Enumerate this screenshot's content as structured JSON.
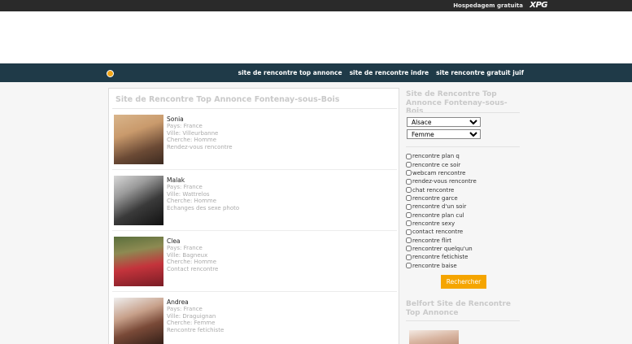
{
  "topbar": {
    "hosting_label": "Hospedagem gratuita",
    "logo_text": "XPG"
  },
  "nav": {
    "home_icon": "home-star-icon",
    "links": [
      "site de rencontre top annonce",
      "site de rencontre indre",
      "site rencontre gratuit juif"
    ]
  },
  "main": {
    "title": "Site de Rencontre Top Annonce Fontenay-sous-Bois",
    "profiles": [
      {
        "name": "Sonia",
        "pays": "Pays: France",
        "ville": "Ville: Villeurbanne",
        "cherche": "Cherche: Homme",
        "tag": "Rendez-vous rencontre"
      },
      {
        "name": "Malak",
        "pays": "Pays: France",
        "ville": "Ville: Wattrelos",
        "cherche": "Cherche: Homme",
        "tag": "Echanges des sexe photo"
      },
      {
        "name": "Clea",
        "pays": "Pays: France",
        "ville": "Ville: Bagneux",
        "cherche": "Cherche: Homme",
        "tag": "Contact rencontre"
      },
      {
        "name": "Andrea",
        "pays": "Pays: France",
        "ville": "Ville: Draguignan",
        "cherche": "Cherche: Femme",
        "tag": "Rencontre fetichiste"
      }
    ]
  },
  "sidebar": {
    "title": "Site de Rencontre Top Annonce Fontenay-sous-Bois",
    "region_value": "Alsace",
    "gender_value": "Femme",
    "checkboxes": [
      "rencontre plan q",
      "rencontre ce soir",
      "webcam rencontre",
      "rendez-vous rencontre",
      "chat rencontre",
      "rencontre garce",
      "rencontre d'un soir",
      "rencontre plan cul",
      "rencontre sexy",
      "contact rencontre",
      "rencontre flirt",
      "rencontrer quelqu'un",
      "rencontre fetichiste",
      "rencontre baise"
    ],
    "search_button": "Rechercher",
    "title2": "Belfort Site de Rencontre Top Annonce"
  }
}
